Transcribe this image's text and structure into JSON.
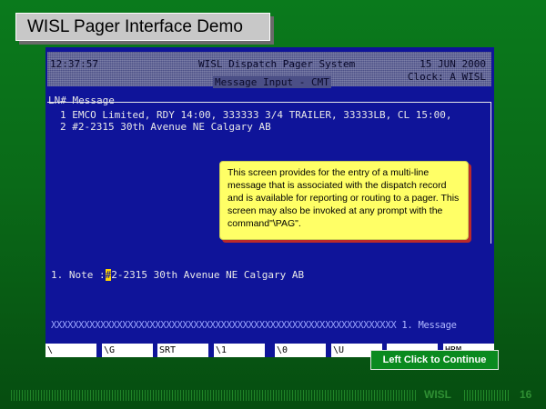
{
  "slide": {
    "title": "WISL Pager Interface Demo",
    "continue_label": "Left Click to Continue",
    "brand": "WISL",
    "page_number": "16"
  },
  "terminal": {
    "time": "12:37:57",
    "system_title": "WISL Dispatch Pager System",
    "date": "15 JUN 2000",
    "clock": "Clock: A WISL",
    "screen_title": "Message Input - CMT",
    "message_header": "LN# Message",
    "messages": [
      "1 EMCO Limited, RDY 14:00, 333333 3/4 TRAILER, 33333LB, CL 15:00,",
      "2 #2-2315 30th Avenue NE Calgary AB"
    ],
    "note": {
      "label": "1. Note :",
      "cursor_char": "#",
      "value": "2-2315 30th Avenue NE Calgary AB"
    },
    "x_line": "XXXXXXXXXXXXXXXXXXXXXXXXXXXXXXXXXXXXXXXXXXXXXXXXXXXXXXXXXXXXXXX",
    "x_line_label": "1. Message",
    "function_keys": [
      "\\",
      "\\G",
      "SRT",
      "\\1",
      "\\0",
      "\\U",
      "",
      "HRM"
    ]
  },
  "tooltip": {
    "text": "This screen provides for the entry of a multi-line message that is associated with the dispatch record and is available for reporting or routing to a pager. This screen may also be invoked at any prompt with the command\"\\PAG\"."
  }
}
